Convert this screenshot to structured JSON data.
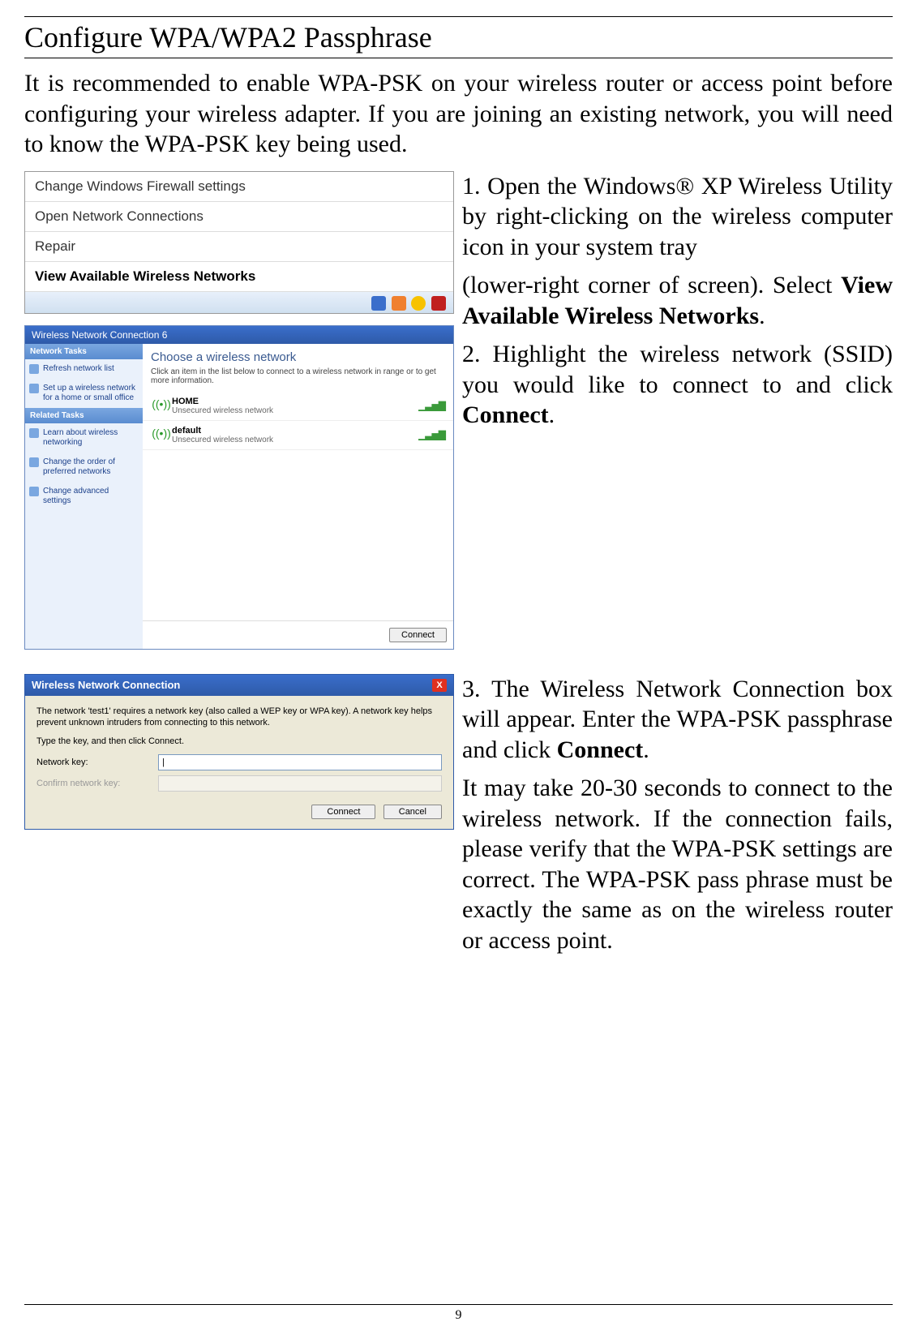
{
  "page": {
    "title": "Configure WPA/WPA2 Passphrase",
    "intro": "It is recommended to enable WPA-PSK on your wireless router or access point before configuring your wireless adapter. If you are joining an existing network, you will need to know the WPA-PSK key being used.",
    "number": "9"
  },
  "step1": {
    "text_a": "1. Open the Windows® XP Wireless Utility by right-clicking on the wireless computer icon in your system tray",
    "text_b_prefix": "(lower-right corner of screen). Select ",
    "text_b_bold": "View Available Wireless Networks",
    "text_b_suffix": "."
  },
  "step2": {
    "prefix": "2. Highlight the wireless network (SSID) you would like to connect to and click ",
    "bold": "Connect",
    "suffix": "."
  },
  "step3": {
    "prefix": "3. The Wireless Network Connection box will appear. Enter the WPA-PSK passphrase and click ",
    "bold": "Connect",
    "suffix": "."
  },
  "final": "It may take 20-30 seconds to connect to the wireless network. If the connection fails, please verify that the WPA-PSK settings are correct. The WPA-PSK pass phrase must be exactly the same as on the wireless router or access point.",
  "context_menu": {
    "item1": "Change Windows Firewall settings",
    "item2": "Open Network Connections",
    "item3": "Repair",
    "item4": "View Available Wireless Networks"
  },
  "choose": {
    "titlebar": "Wireless Network Connection 6",
    "sidebar": {
      "head1": "Network Tasks",
      "task1": "Refresh network list",
      "task2": "Set up a wireless network for a home or small office",
      "head2": "Related Tasks",
      "task3": "Learn about wireless networking",
      "task4": "Change the order of preferred networks",
      "task5": "Change advanced settings"
    },
    "main_title": "Choose a wireless network",
    "main_sub": "Click an item in the list below to connect to a wireless network in range or to get more information.",
    "net1": {
      "name": "HOME",
      "sub": "Unsecured wireless network"
    },
    "net2": {
      "name": "default",
      "sub": "Unsecured wireless network"
    },
    "connect": "Connect"
  },
  "keydlg": {
    "title": "Wireless Network Connection",
    "close": "X",
    "desc1": "The network 'test1' requires a network key (also called a WEP key or WPA key). A network key helps prevent unknown intruders from connecting to this network.",
    "desc2": "Type the key, and then click Connect.",
    "label1": "Network key:",
    "label2": "Confirm network key:",
    "value1": "|",
    "btn_connect": "Connect",
    "btn_cancel": "Cancel"
  }
}
